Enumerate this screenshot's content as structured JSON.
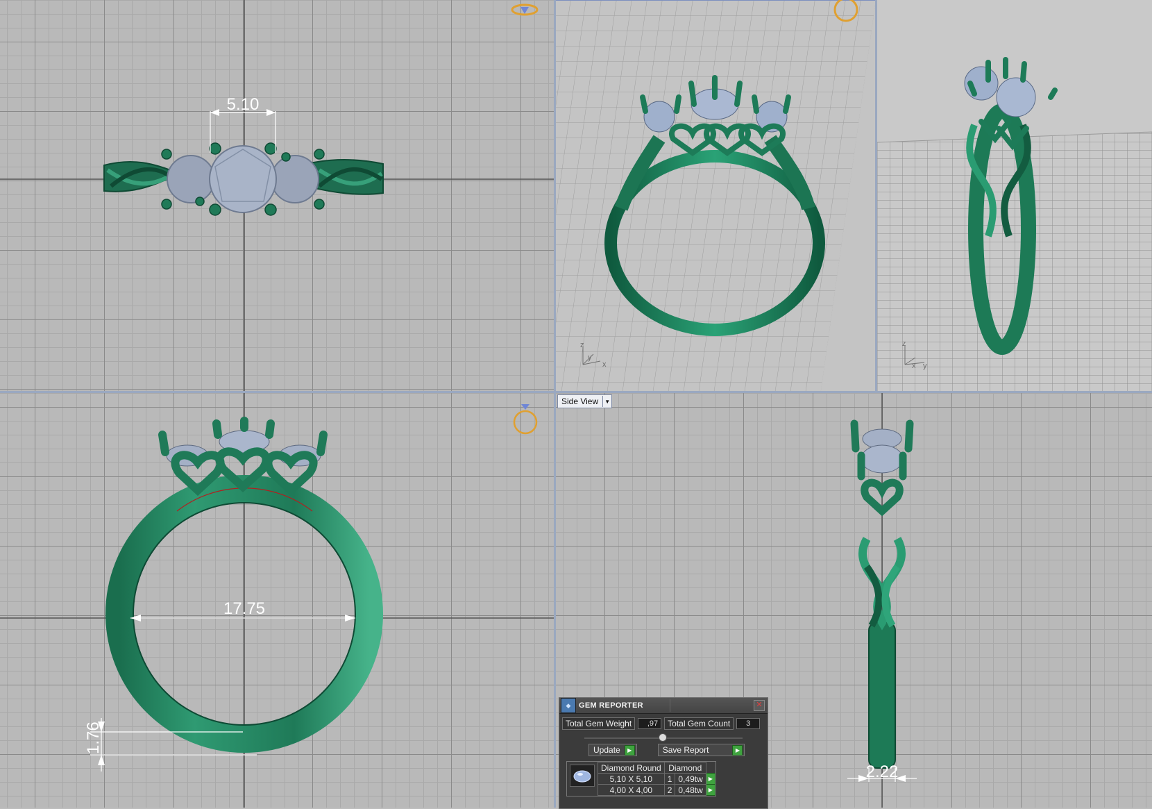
{
  "viewports": {
    "top_view": {
      "dimension": "5.10"
    },
    "front_view": {
      "inner_diameter": "17.75",
      "band_thickness": "1.76"
    },
    "side_view": {
      "label": "Side View",
      "band_width": "2.22"
    },
    "perspective_left": {
      "axes": [
        "z",
        "y",
        "x"
      ]
    },
    "perspective_right": {
      "axes": [
        "z",
        "x",
        "y"
      ]
    }
  },
  "colors": {
    "ring": "#1f7a58",
    "gem": "#a9b5cc",
    "grid_bg": "#b9b9b9",
    "dimension": "#ffffff",
    "gizmo": "#e0a030"
  },
  "gem_reporter": {
    "title": "GEM REPORTER",
    "total_gem_weight_label": "Total Gem Weight",
    "total_gem_weight": ",97",
    "total_gem_count_label": "Total Gem Count",
    "total_gem_count": "3",
    "update_label": "Update",
    "save_report_label": "Save Report",
    "table": {
      "headers": [
        "Diamond Round",
        "Diamond"
      ],
      "rows": [
        {
          "size": "5,10 X 5,10",
          "count": "1",
          "weight": "0,49tw"
        },
        {
          "size": "4,00 X 4,00",
          "count": "2",
          "weight": "0,48tw"
        }
      ]
    }
  }
}
